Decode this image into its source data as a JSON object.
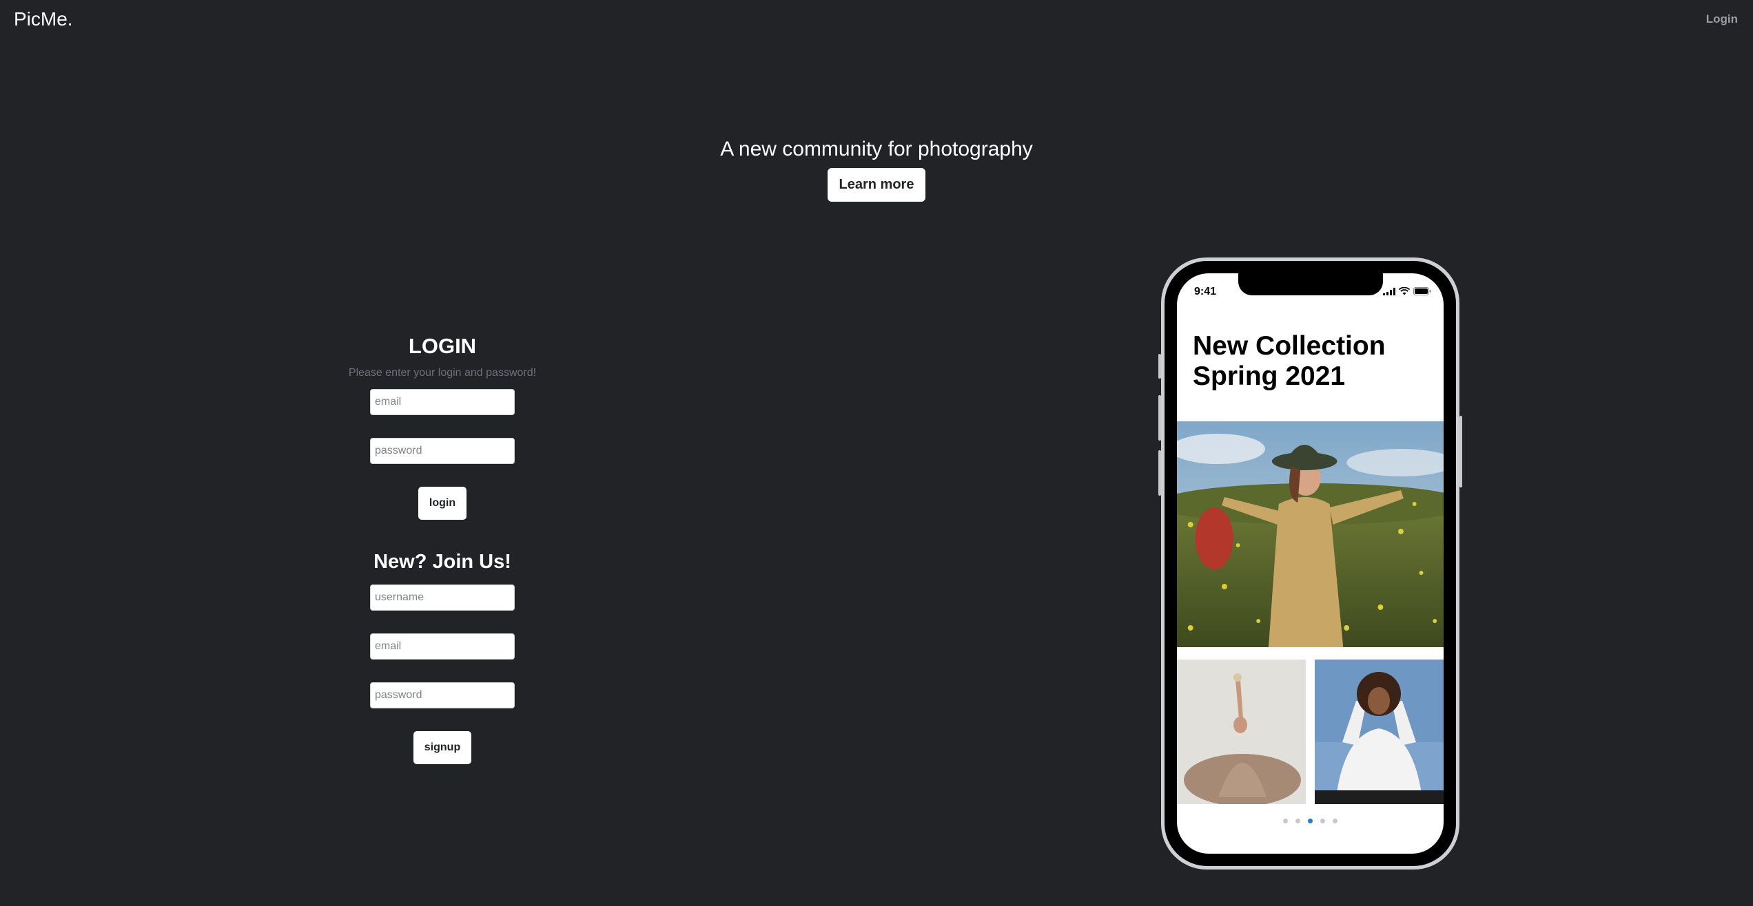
{
  "nav": {
    "brand": "PicMe.",
    "login_link": "Login"
  },
  "hero": {
    "title": "A new community for photography",
    "learn_more": "Learn more"
  },
  "login_form": {
    "title": "LOGIN",
    "subtitle": "Please enter your login and password!",
    "email_placeholder": "email",
    "password_placeholder": "password",
    "submit": "login"
  },
  "signup_form": {
    "title": "New? Join Us!",
    "username_placeholder": "username",
    "email_placeholder": "email",
    "password_placeholder": "password",
    "submit": "signup"
  },
  "phone": {
    "status_time": "9:41",
    "status_icons": [
      "signal-icon",
      "wifi-icon",
      "battery-icon"
    ],
    "collection_title_line1": "New Collection",
    "collection_title_line2": "Spring 2021",
    "carousel": {
      "count": 5,
      "active_index": 2
    }
  },
  "colors": {
    "background": "#212327",
    "accent": "#1d7fd8",
    "text_muted": "#6d7076"
  }
}
